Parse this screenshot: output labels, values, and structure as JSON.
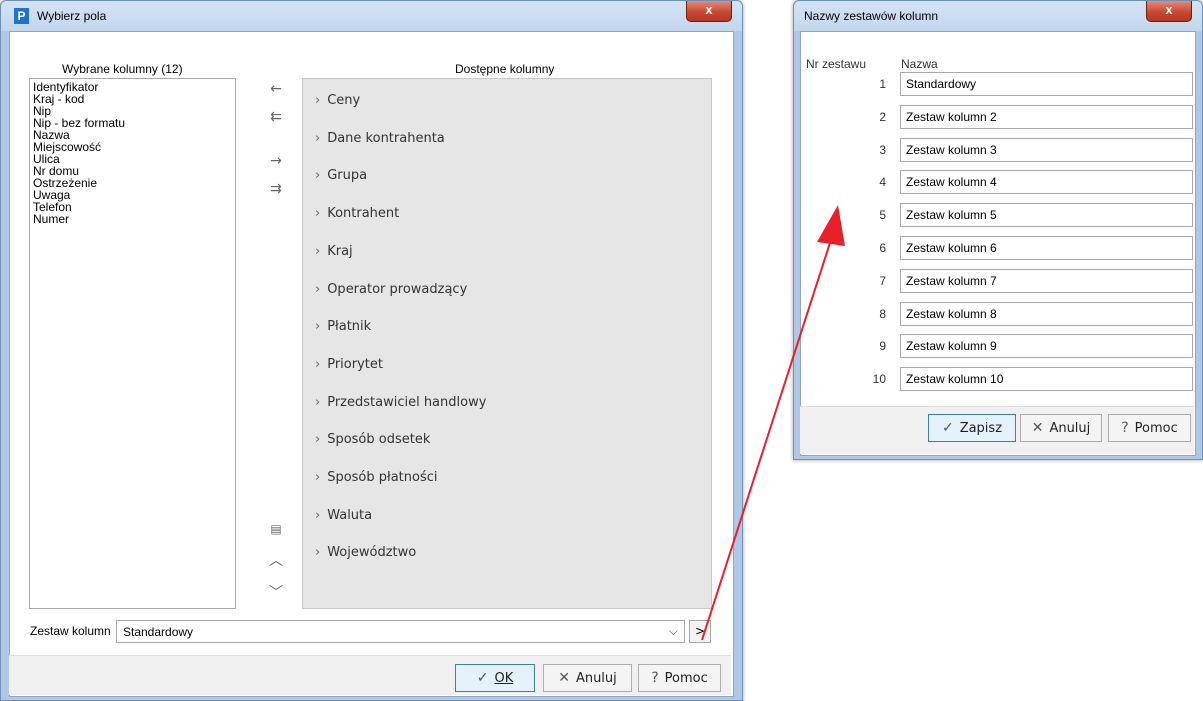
{
  "left_dialog": {
    "title": "Wybierz pola",
    "close_label": "x",
    "selected_header": "Wybrane kolumny (12)",
    "available_header": "Dostępne kolumny",
    "selected_items": [
      "Identyfikator",
      "Kraj - kod",
      "Nip",
      "Nip - bez formatu",
      "Nazwa",
      "Miejscowość",
      "Ulica",
      "Nr domu",
      "Ostrzeżenie",
      "Uwaga",
      "Telefon",
      "Numer"
    ],
    "available_items": [
      "Ceny",
      "Dane kontrahenta",
      "Grupa",
      "Kontrahent",
      "Kraj",
      "Operator prowadzący",
      "Płatnik",
      "Priorytet",
      "Przedstawiciel handlowy",
      "Sposób odsetek",
      "Sposób płatności",
      "Waluta",
      "Województwo"
    ],
    "column_set_label": "Zestaw kolumn",
    "column_set_value": "Standardowy",
    "buttons": {
      "ok": "OK",
      "cancel": "Anuluj",
      "help": "Pomoc"
    }
  },
  "right_dialog": {
    "title": "Nazwy zestawów kolumn",
    "close_label": "x",
    "col_number_header": "Nr zestawu",
    "col_name_header": "Nazwa",
    "rows": [
      {
        "num": "1",
        "name": "Standardowy"
      },
      {
        "num": "2",
        "name": "Zestaw kolumn 2"
      },
      {
        "num": "3",
        "name": "Zestaw kolumn 3"
      },
      {
        "num": "4",
        "name": "Zestaw kolumn 4"
      },
      {
        "num": "5",
        "name": "Zestaw kolumn 5"
      },
      {
        "num": "6",
        "name": "Zestaw kolumn 6"
      },
      {
        "num": "7",
        "name": "Zestaw kolumn 7"
      },
      {
        "num": "8",
        "name": "Zestaw kolumn 8"
      },
      {
        "num": "9",
        "name": "Zestaw kolumn 9"
      },
      {
        "num": "10",
        "name": "Zestaw kolumn 10"
      }
    ],
    "buttons": {
      "save": "Zapisz",
      "cancel": "Anuluj",
      "help": "Pomoc"
    }
  },
  "colors": {
    "annotation_arrow": "#e8202a",
    "title_bar": "#c2d6ee",
    "close_button": "#c74a35"
  },
  "icons": [
    "app-icon",
    "close-icon",
    "chevron-right-icon",
    "arrow-left-icon",
    "arrow-left-double-icon",
    "arrow-right-icon",
    "arrow-right-double-icon",
    "column-set-icon",
    "chevron-up-icon",
    "chevron-down-icon",
    "check-icon",
    "cross-icon",
    "help-icon"
  ]
}
